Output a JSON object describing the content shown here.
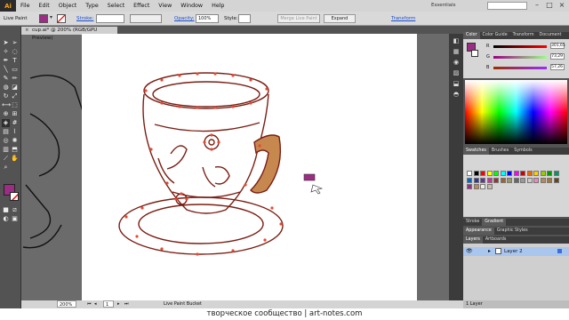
{
  "app": {
    "logo": "Ai"
  },
  "menu": [
    "File",
    "Edit",
    "Object",
    "Type",
    "Select",
    "Effect",
    "View",
    "Window",
    "Help"
  ],
  "workspace": {
    "essentials": "Essentials",
    "search_placeholder": ""
  },
  "control": {
    "tool_name": "Live Paint",
    "stroke_label": "Stroke:",
    "opacity_label": "Opacity:",
    "opacity_value": "100%",
    "style_label": "Style:",
    "merge_label": "Merge Live Paint",
    "expand_label": "Expand",
    "transform_label": "Transform"
  },
  "document": {
    "tab_title": "cup.ai* @ 200% (RGB/GPU Preview)"
  },
  "status": {
    "zoom": "200%",
    "page": "1",
    "tool": "Live Paint Bucket"
  },
  "caption": "творческое сообщество | art-notes.com",
  "color_panel": {
    "tabs": [
      "Color",
      "Color Guide",
      "Transform",
      "Document"
    ],
    "channels": [
      {
        "label": "R",
        "value": "301,65"
      },
      {
        "label": "G",
        "value": "73,29"
      },
      {
        "label": "B",
        "value": "57,26"
      }
    ]
  },
  "swatches_panel": {
    "tabs": [
      "Swatches",
      "Brushes",
      "Symbols"
    ]
  },
  "stroke_panel": {
    "tabs": [
      "Stroke",
      "Gradient"
    ]
  },
  "appearance_panel": {
    "tabs": [
      "Appearance",
      "Graphic Styles"
    ]
  },
  "layers_panel": {
    "tabs": [
      "Layers",
      "Artboards"
    ],
    "layer_name": "Layer 2",
    "footer": "1 Layer"
  },
  "colors": {
    "fill": "#9b2d84",
    "accent": "#c7884f",
    "stroke_art": "#e34a32",
    "outline": "#7a1f14"
  }
}
